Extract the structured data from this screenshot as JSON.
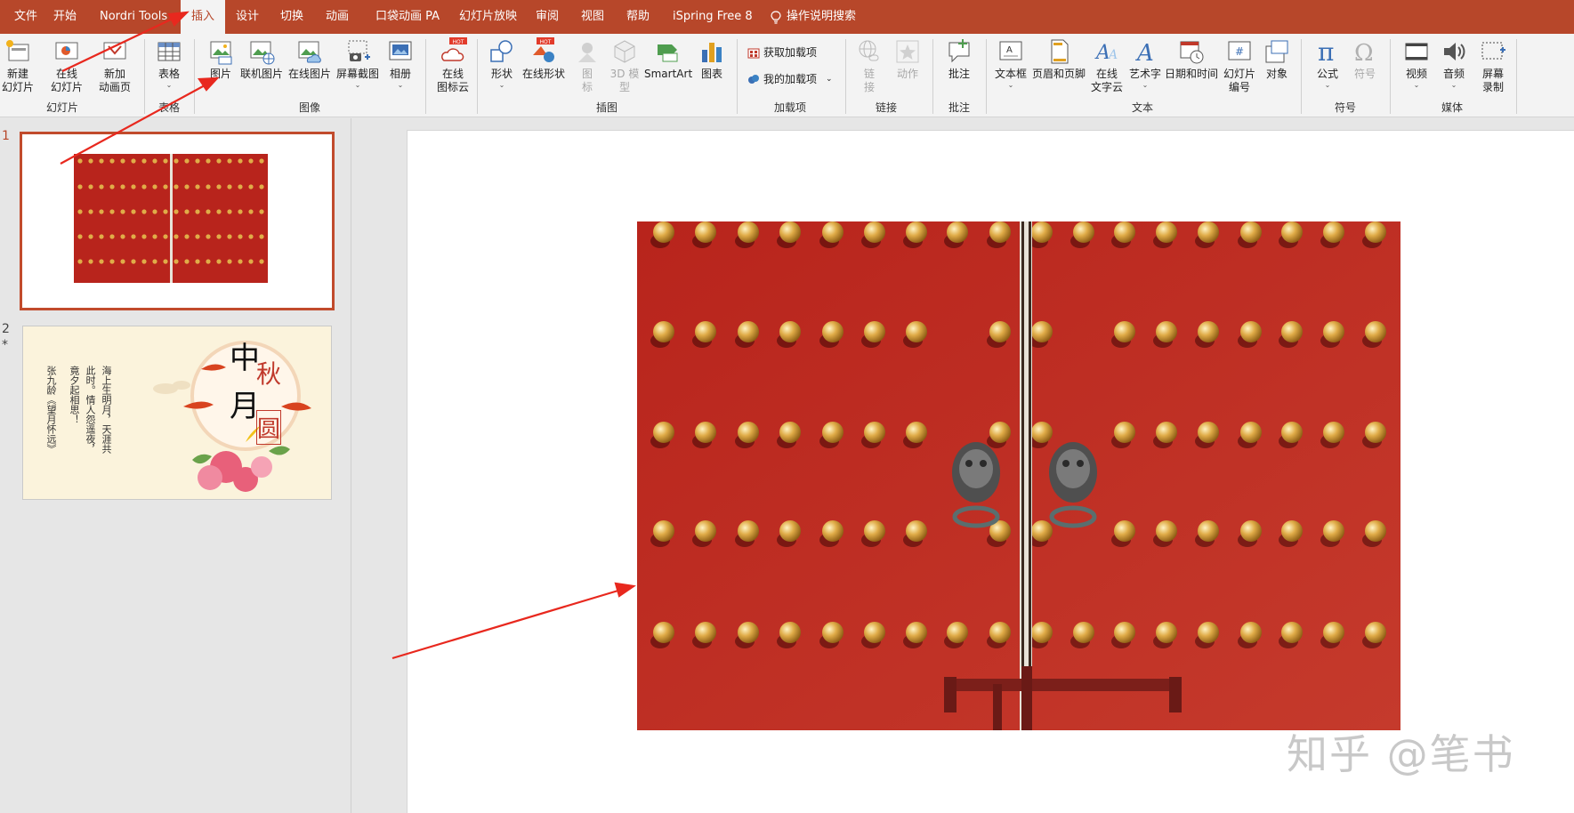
{
  "tabs": [
    "文件",
    "开始",
    "Nordri Tools",
    "插入",
    "设计",
    "切换",
    "动画",
    "口袋动画 PA",
    "幻灯片放映",
    "审阅",
    "视图",
    "帮助",
    "iSpring Free 8"
  ],
  "active_tab": "插入",
  "search": {
    "label": "操作说明搜索"
  },
  "ribbon": {
    "new_slide": {
      "l1": "新建",
      "l2": "幻灯片"
    },
    "online_slide": {
      "l1": "在线",
      "l2": "幻灯片"
    },
    "new_anim_page": {
      "l1": "新加",
      "l2": "动画页"
    },
    "group_slides": "幻灯片",
    "table": {
      "l1": "表格"
    },
    "group_table": "表格",
    "picture": {
      "l1": "图片"
    },
    "online_picture_lib": {
      "l1": "联机图片"
    },
    "online_picture": {
      "l1": "在线图片"
    },
    "screenshot": {
      "l1": "屏幕截图"
    },
    "album": {
      "l1": "相册"
    },
    "group_image": "图像",
    "online_icon_cloud": {
      "l1": "在线",
      "l2": "图标云",
      "badge": "HOT"
    },
    "shapes": {
      "l1": "形状"
    },
    "online_shapes": {
      "l1": "在线形状",
      "badge": "HOT"
    },
    "icons": {
      "l1": "图",
      "l2": "标"
    },
    "models3d": {
      "l1": "3D 模",
      "l2": "型"
    },
    "smartart": {
      "l1": "SmartArt"
    },
    "chart": {
      "l1": "图表"
    },
    "group_illustrations": "插图",
    "get_addins": "获取加载项",
    "my_addins": "我的加载项",
    "group_addins": "加载项",
    "link": {
      "l1": "链",
      "l2": "接"
    },
    "action": {
      "l1": "动作"
    },
    "group_links": "链接",
    "comment": {
      "l1": "批注"
    },
    "group_comments": "批注",
    "textbox": {
      "l1": "文本框"
    },
    "header_footer": {
      "l1": "页眉和页脚"
    },
    "online_text_cloud": {
      "l1": "在线",
      "l2": "文字云"
    },
    "wordart": {
      "l1": "艺术字"
    },
    "date_time": {
      "l1": "日期和时间"
    },
    "slide_number": {
      "l1": "幻灯片",
      "l2": "编号"
    },
    "object": {
      "l1": "对象"
    },
    "group_text": "文本",
    "equation": {
      "l1": "公式"
    },
    "symbol": {
      "l1": "符号"
    },
    "group_symbols": "符号",
    "video": {
      "l1": "视频"
    },
    "audio": {
      "l1": "音频"
    },
    "screen_record": {
      "l1": "屏幕",
      "l2": "录制"
    },
    "group_media": "媒体"
  },
  "thumbnails": {
    "slide1_number": "1",
    "slide2_number": "2",
    "slide2_marker": "*",
    "slide2_title_chars": [
      "中",
      "秋",
      "月",
      "圆"
    ],
    "slide2_poem_columns": [
      "海上生明月，天涯共",
      "此时。情人怨遥夜，",
      "竟夕起相思！",
      "张九龄《望月怀远》"
    ]
  },
  "watermark": "知乎 @笔书",
  "colors": {
    "accent": "#b7472a",
    "door_red": "#b8241c",
    "stud_gold": "#d9a442",
    "arrow": "#e8281e"
  }
}
